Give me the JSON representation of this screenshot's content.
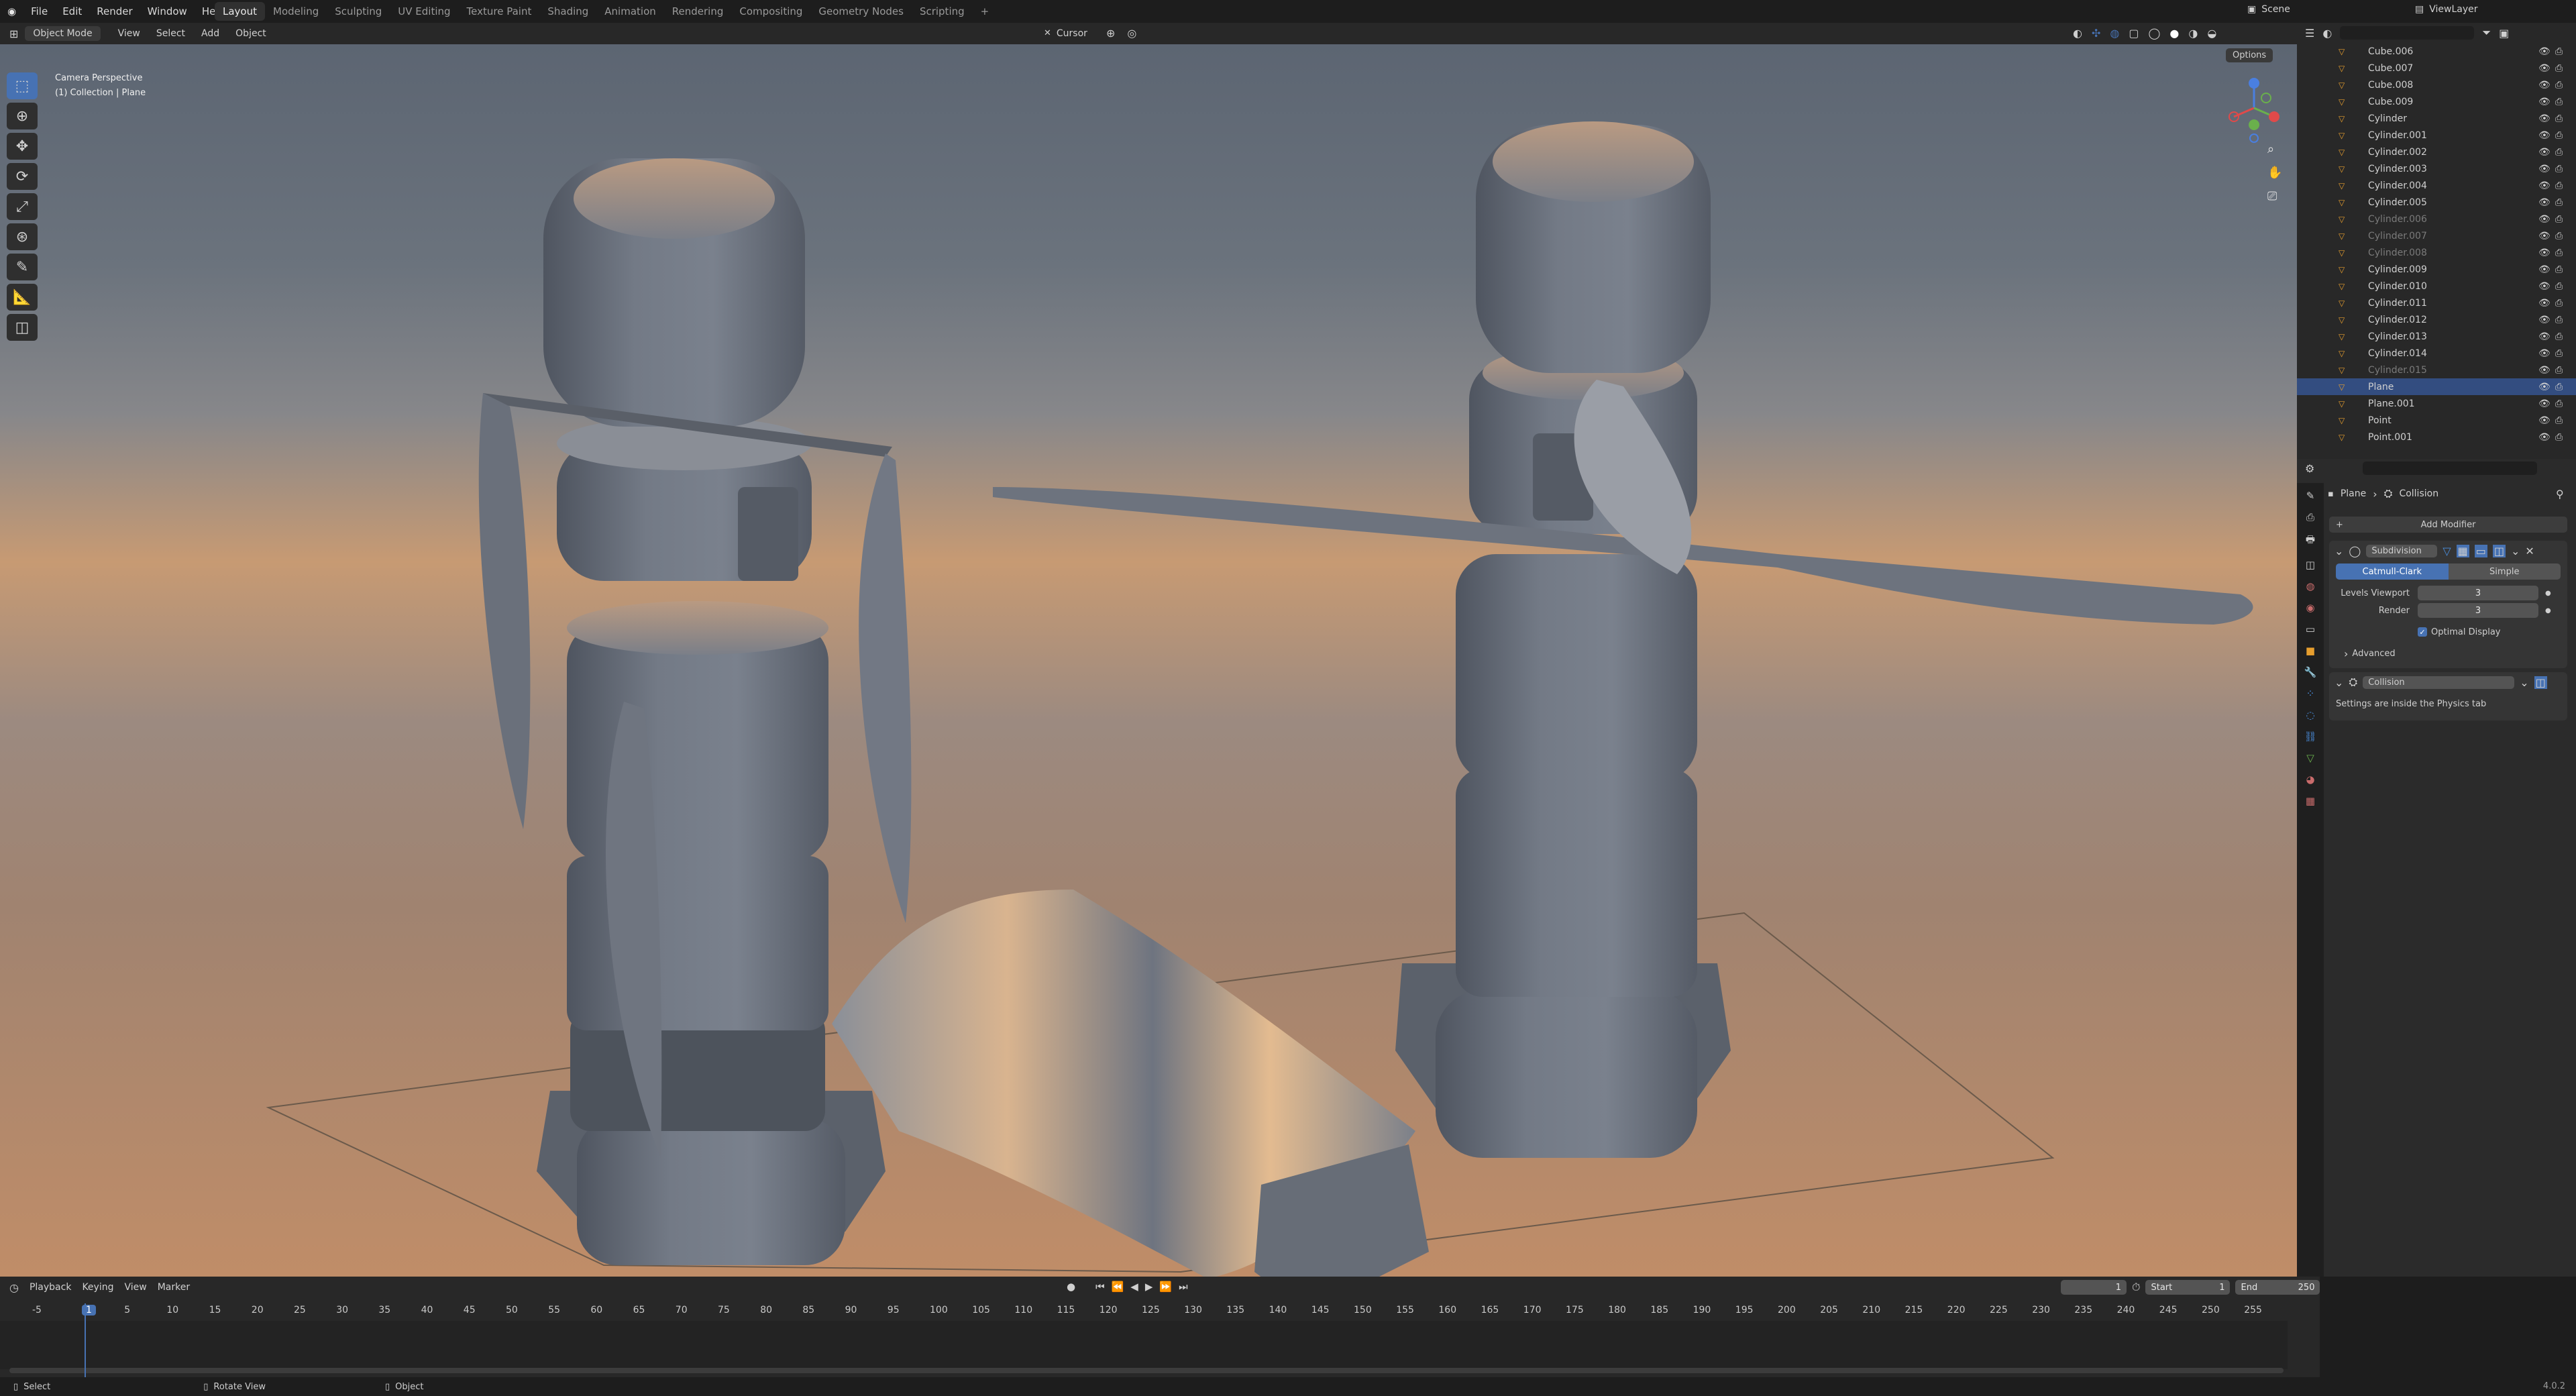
{
  "menu": {
    "items": [
      "File",
      "Edit",
      "Render",
      "Window",
      "Help"
    ]
  },
  "workspaces": [
    "Layout",
    "Modeling",
    "Sculpting",
    "UV Editing",
    "Texture Paint",
    "Shading",
    "Animation",
    "Rendering",
    "Compositing",
    "Geometry Nodes",
    "Scripting"
  ],
  "active_workspace": "Layout",
  "scene": {
    "label": "Scene",
    "view_layer": "ViewLayer"
  },
  "viewport_header": {
    "mode": "Object Mode",
    "menus": [
      "View",
      "Select",
      "Add",
      "Object"
    ],
    "pivot": "Cursor",
    "options": "Options"
  },
  "viewport": {
    "overlay_line1": "Camera Perspective",
    "overlay_line2": "(1) Collection | Plane"
  },
  "outliner": {
    "items": [
      {
        "name": "Cube.006",
        "dim": false,
        "sel": false
      },
      {
        "name": "Cube.007",
        "dim": false,
        "sel": false
      },
      {
        "name": "Cube.008",
        "dim": false,
        "sel": false
      },
      {
        "name": "Cube.009",
        "dim": false,
        "sel": false
      },
      {
        "name": "Cylinder",
        "dim": false,
        "sel": false
      },
      {
        "name": "Cylinder.001",
        "dim": false,
        "sel": false
      },
      {
        "name": "Cylinder.002",
        "dim": false,
        "sel": false
      },
      {
        "name": "Cylinder.003",
        "dim": false,
        "sel": false
      },
      {
        "name": "Cylinder.004",
        "dim": false,
        "sel": false
      },
      {
        "name": "Cylinder.005",
        "dim": false,
        "sel": false
      },
      {
        "name": "Cylinder.006",
        "dim": true,
        "sel": false
      },
      {
        "name": "Cylinder.007",
        "dim": true,
        "sel": false
      },
      {
        "name": "Cylinder.008",
        "dim": true,
        "sel": false
      },
      {
        "name": "Cylinder.009",
        "dim": false,
        "sel": false
      },
      {
        "name": "Cylinder.010",
        "dim": false,
        "sel": false
      },
      {
        "name": "Cylinder.011",
        "dim": false,
        "sel": false
      },
      {
        "name": "Cylinder.012",
        "dim": false,
        "sel": false
      },
      {
        "name": "Cylinder.013",
        "dim": false,
        "sel": false
      },
      {
        "name": "Cylinder.014",
        "dim": false,
        "sel": false
      },
      {
        "name": "Cylinder.015",
        "dim": true,
        "sel": false
      },
      {
        "name": "Plane",
        "dim": false,
        "sel": true
      },
      {
        "name": "Plane.001",
        "dim": false,
        "sel": false
      },
      {
        "name": "Point",
        "dim": false,
        "sel": false
      },
      {
        "name": "Point.001",
        "dim": false,
        "sel": false
      }
    ]
  },
  "properties": {
    "breadcrumb_object": "Plane",
    "breadcrumb_modifier": "Collision",
    "add_modifier": "Add Modifier",
    "subdivision": {
      "name": "Subdivision",
      "mode_a": "Catmull-Clark",
      "mode_b": "Simple",
      "levels_viewport_label": "Levels Viewport",
      "levels_viewport": "3",
      "render_label": "Render",
      "render": "3",
      "optimal_display": "Optimal Display",
      "advanced": "Advanced"
    },
    "collision": {
      "name": "Collision",
      "note": "Settings are inside the Physics tab"
    }
  },
  "timeline": {
    "menus": [
      "Playback",
      "Keying",
      "View",
      "Marker"
    ],
    "current_frame": "1",
    "start_label": "Start",
    "start": "1",
    "end_label": "End",
    "end": "250",
    "ticks": [
      "-5",
      "1",
      "5",
      "10",
      "15",
      "20",
      "25",
      "30",
      "35",
      "40",
      "45",
      "50",
      "55",
      "60",
      "65",
      "70",
      "75",
      "80",
      "85",
      "90",
      "95",
      "100",
      "105",
      "110",
      "115",
      "120",
      "125",
      "130",
      "135",
      "140",
      "145",
      "150",
      "155",
      "160",
      "165",
      "170",
      "175",
      "180",
      "185",
      "190",
      "195",
      "200",
      "205",
      "210",
      "215",
      "220",
      "225",
      "230",
      "235",
      "240",
      "245",
      "250",
      "255"
    ]
  },
  "status_bar": {
    "select": "Select",
    "rotate": "Rotate View",
    "object": "Object",
    "version": "4.0.2"
  },
  "colors": {
    "accent": "#4772b3",
    "selected_row": "#334d80",
    "mesh_icon": "#e69e2e",
    "gizmo_x": "#e04a4a",
    "gizmo_y": "#6ab04c",
    "gizmo_z": "#4a7fe0"
  }
}
